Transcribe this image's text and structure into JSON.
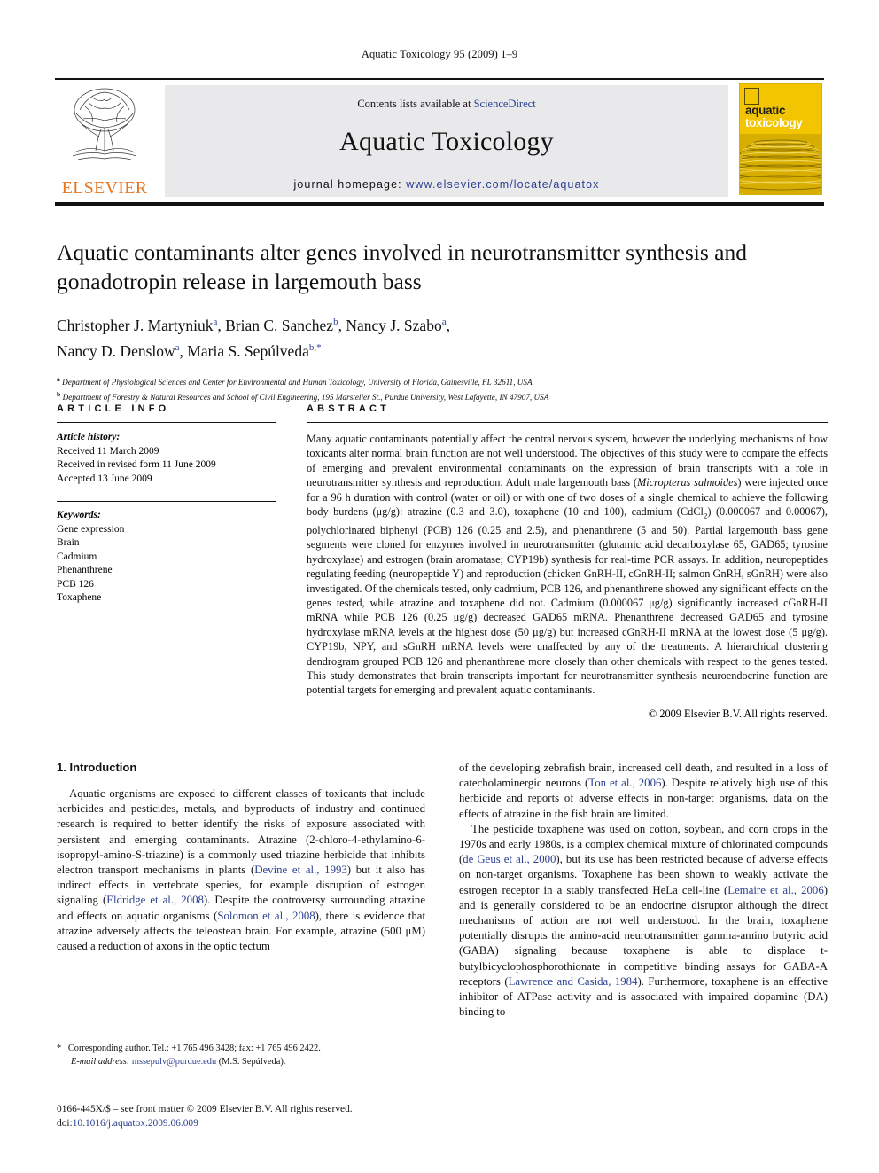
{
  "running_head": "Aquatic Toxicology 95 (2009) 1–9",
  "masthead": {
    "contents_prefix": "Contents lists available at ",
    "sciencedirect": "ScienceDirect",
    "journal_name": "Aquatic Toxicology",
    "homepage_prefix": "journal homepage: ",
    "homepage_url": "www.elsevier.com/locate/aquatox",
    "publisher": "ELSEVIER",
    "cover_title_line1": "aquatic",
    "cover_title_line2": "toxicology",
    "accent_orange": "#E87722",
    "accent_yellow": "#f2c500",
    "link_blue": "#2a3f8f"
  },
  "article": {
    "title": "Aquatic contaminants alter genes involved in neurotransmitter synthesis and gonadotropin release in largemouth bass",
    "authors_line1": "Christopher J. Martyniuk",
    "authors": [
      {
        "name": "Christopher J. Martyniuk",
        "sup": "a"
      },
      {
        "name": "Brian C. Sanchez",
        "sup": "b"
      },
      {
        "name": "Nancy J. Szabo",
        "sup": "a"
      },
      {
        "name": "Nancy D. Denslow",
        "sup": "a"
      },
      {
        "name": "Maria S. Sepúlveda",
        "sup": "b,*"
      }
    ],
    "affiliations": [
      {
        "sup": "a",
        "text": "Department of Physiological Sciences and Center for Environmental and Human Toxicology, University of Florida, Gainesville, FL 32611, USA"
      },
      {
        "sup": "b",
        "text": "Department of Forestry & Natural Resources and School of Civil Engineering, 195 Marsteller St., Purdue University, West Lafayette, IN 47907, USA"
      }
    ]
  },
  "article_info": {
    "heading": "ARTICLE INFO",
    "history_label": "Article history:",
    "history": [
      "Received 11 March 2009",
      "Received in revised form 11 June 2009",
      "Accepted 13 June 2009"
    ],
    "keywords_label": "Keywords:",
    "keywords": [
      "Gene expression",
      "Brain",
      "Cadmium",
      "Phenanthrene",
      "PCB 126",
      "Toxaphene"
    ]
  },
  "abstract": {
    "heading": "ABSTRACT",
    "part1": "Many aquatic contaminants potentially affect the central nervous system, however the underlying mechanisms of how toxicants alter normal brain function are not well understood. The objectives of this study were to compare the effects of emerging and prevalent environmental contaminants on the expression of brain transcripts with a role in neurotransmitter synthesis and reproduction. Adult male largemouth bass (",
    "species": "Micropterus salmoides",
    "part2": ") were injected once for a 96 h duration with control (water or oil) or with one of two doses of a single chemical to achieve the following body burdens (μg/g): atrazine (0.3 and 3.0), toxaphene (10 and 100), cadmium (CdCl",
    "sub2": "2",
    "part3": ") (0.000067 and 0.00067), polychlorinated biphenyl (PCB) 126 (0.25 and 2.5), and phenanthrene (5 and 50). Partial largemouth bass gene segments were cloned for enzymes involved in neurotransmitter (glutamic acid decarboxylase 65, GAD65; tyrosine hydroxylase) and estrogen (brain aromatase; CYP19b) synthesis for real-time PCR assays. In addition, neuropeptides regulating feeding (neuropeptide Y) and reproduction (chicken GnRH-II, cGnRH-II; salmon GnRH, sGnRH) were also investigated. Of the chemicals tested, only cadmium, PCB 126, and phenanthrene showed any significant effects on the genes tested, while atrazine and toxaphene did not. Cadmium (0.000067 μg/g) significantly increased cGnRH-II mRNA while PCB 126 (0.25 μg/g) decreased GAD65 mRNA. Phenanthrene decreased GAD65 and tyrosine hydroxylase mRNA levels at the highest dose (50 μg/g) but increased cGnRH-II mRNA at the lowest dose (5 μg/g). CYP19b, NPY, and sGnRH mRNA levels were unaffected by any of the treatments. A hierarchical clustering dendrogram grouped PCB 126 and phenanthrene more closely than other chemicals with respect to the genes tested. This study demonstrates that brain transcripts important for neurotransmitter synthesis neuroendocrine function are potential targets for emerging and prevalent aquatic contaminants.",
    "copyright": "© 2009 Elsevier B.V. All rights reserved."
  },
  "introduction": {
    "heading": "1. Introduction",
    "left_p1_a": "Aquatic organisms are exposed to different classes of toxicants that include herbicides and pesticides, metals, and byproducts of industry and continued research is required to better identify the risks of exposure associated with persistent and emerging contaminants. Atrazine (2-chloro-4-ethylamino-6-isopropyl-amino-S-triazine) is a commonly used triazine herbicide that inhibits electron transport mechanisms in plants (",
    "ref_devine": "Devine et al., 1993",
    "left_p1_b": ") but it also has indirect effects in vertebrate species, for example disruption of estrogen signaling (",
    "ref_eldridge": "Eldridge et al., 2008",
    "left_p1_c": "). Despite the controversy surrounding atrazine and effects on aquatic organisms (",
    "ref_solomon": "Solomon et al., 2008",
    "left_p1_d": "), there is evidence that atrazine adversely affects the teleostean brain. For example, atrazine (500 μM) caused a reduction of axons in the optic tectum",
    "right_p1_a": "of the developing zebrafish brain, increased cell death, and resulted in a loss of catecholaminergic neurons (",
    "ref_ton": "Ton et al., 2006",
    "right_p1_b": "). Despite relatively high use of this herbicide and reports of adverse effects in non-target organisms, data on the effects of atrazine in the fish brain are limited.",
    "right_p2_a": "The pesticide toxaphene was used on cotton, soybean, and corn crops in the 1970s and early 1980s, is a complex chemical mixture of chlorinated compounds (",
    "ref_degeus": "de Geus et al., 2000",
    "right_p2_b": "), but its use has been restricted because of adverse effects on non-target organisms. Toxaphene has been shown to weakly activate the estrogen receptor in a stably transfected HeLa cell-line (",
    "ref_lemaire": "Lemaire et al., 2006",
    "right_p2_c": ") and is generally considered to be an endocrine disruptor although the direct mechanisms of action are not well understood. In the brain, toxaphene potentially disrupts the amino-acid neurotransmitter gamma-amino butyric acid (GABA) signaling because toxaphene is able to displace t-butylbicyclophosphorothionate in competitive binding assays for GABA-A receptors (",
    "ref_lawrence": "Lawrence and Casida, 1984",
    "right_p2_d": "). Furthermore, toxaphene is an effective inhibitor of ATPase activity and is associated with impaired dopamine (DA) binding to"
  },
  "footnotes": {
    "star": "*",
    "corresponding": "Corresponding author. Tel.: +1 765 496 3428; fax: +1 765 496 2422.",
    "email_label": "E-mail address:",
    "email": "mssepulv@purdue.edu",
    "email_owner": "(M.S. Sepúlveda).",
    "issn_line": "0166-445X/$ – see front matter © 2009 Elsevier B.V. All rights reserved.",
    "doi_label": "doi:",
    "doi": "10.1016/j.aquatox.2009.06.009"
  }
}
